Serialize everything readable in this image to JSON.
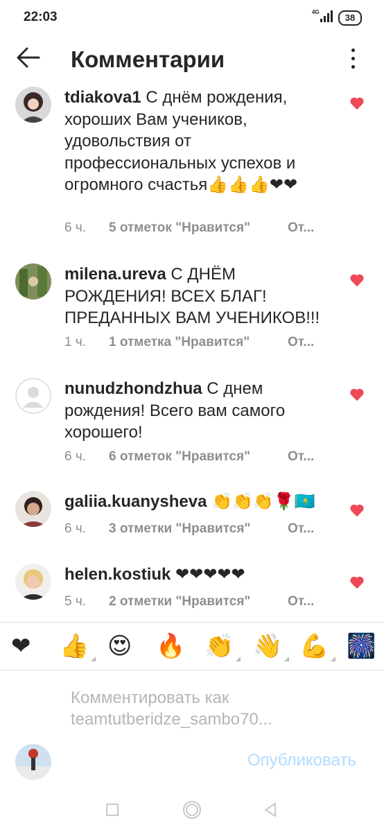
{
  "status_bar": {
    "time": "22:03",
    "network": "4G",
    "battery": "38"
  },
  "header": {
    "title": "Комментарии"
  },
  "comments": [
    {
      "username": "tdiakova1",
      "text": "С днём рождения, хороших Вам учеников, удовольствия от профессиональных успехов и огромного счастья👍👍👍❤❤",
      "time": "6 ч.",
      "likes": "5 отметок \"Нравится\"",
      "reply": "От..."
    },
    {
      "username": "milena.ureva",
      "text": "С ДНЁМ РОЖДЕНИЯ! ВСЕХ БЛАГ! ПРЕДАННЫХ ВАМ УЧЕНИКОВ!!!",
      "time": "1 ч.",
      "likes": "1 отметка \"Нравится\"",
      "reply": "От..."
    },
    {
      "username": "nunudzhondzhua",
      "text": "С днем рождения! Всего вам самого хорошего!",
      "time": "6 ч.",
      "likes": "6 отметок \"Нравится\"",
      "reply": "От..."
    },
    {
      "username": "galiia.kuanysheva",
      "text": "👏👏👏🌹🇰🇿",
      "time": "6 ч.",
      "likes": "3 отметки \"Нравится\"",
      "reply": "От..."
    },
    {
      "username": "helen.kostiuk",
      "text": "❤❤❤❤❤",
      "time": "5 ч.",
      "likes": "2 отметки \"Нравится\"",
      "reply": "От..."
    }
  ],
  "emoji_bar": [
    "❤",
    "👍",
    "😍",
    "🔥",
    "👏",
    "👋",
    "💪",
    "🎆"
  ],
  "composer": {
    "placeholder": "Комментировать как teamtutberidze_sambo70...",
    "publish_label": "Опубликовать"
  },
  "colors": {
    "heart": "#ed4956",
    "publish": "#b3dbff",
    "meta": "#8e8e8e"
  }
}
